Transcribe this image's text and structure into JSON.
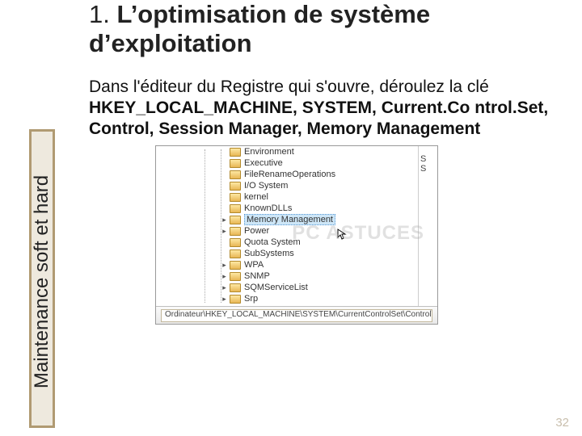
{
  "sidebar": {
    "label": "Maintenance soft et hard"
  },
  "title": {
    "num": "1. ",
    "text": "L’optimisation de système d’exploitation"
  },
  "para": {
    "intro": "Dans l'éditeur du Registre qui s'ouvre, déroulez la clé ",
    "bold": "HKEY_LOCAL_MACHINE, SYSTEM, Current.Co ntrol.Set, Control, Session Manager, Memory Management"
  },
  "registry": {
    "items": [
      {
        "label": "Environment",
        "expandable": false,
        "selected": false
      },
      {
        "label": "Executive",
        "expandable": false,
        "selected": false
      },
      {
        "label": "FileRenameOperations",
        "expandable": false,
        "selected": false
      },
      {
        "label": "I/O System",
        "expandable": false,
        "selected": false
      },
      {
        "label": "kernel",
        "expandable": false,
        "selected": false
      },
      {
        "label": "KnownDLLs",
        "expandable": false,
        "selected": false
      },
      {
        "label": "Memory Management",
        "expandable": true,
        "selected": true
      },
      {
        "label": "Power",
        "expandable": true,
        "selected": false
      },
      {
        "label": "Quota System",
        "expandable": false,
        "selected": false
      },
      {
        "label": "SubSystems",
        "expandable": false,
        "selected": false
      },
      {
        "label": "WPA",
        "expandable": true,
        "selected": false
      },
      {
        "label": "SNMP",
        "expandable": true,
        "selected": false
      },
      {
        "label": "SQMServiceList",
        "expandable": true,
        "selected": false
      },
      {
        "label": "Srp",
        "expandable": true,
        "selected": false
      }
    ],
    "right_hints": [
      "S",
      "S"
    ],
    "address": "Ordinateur\\HKEY_LOCAL_MACHINE\\SYSTEM\\CurrentControlSet\\Control\\Session Ma"
  },
  "page_number": "32"
}
